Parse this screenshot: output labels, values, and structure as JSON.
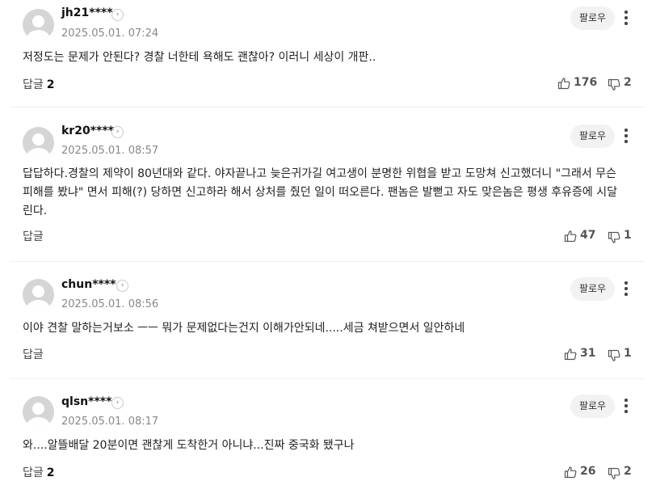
{
  "follow_label": "팔로우",
  "reply_label": "답글",
  "comments": [
    {
      "username": "jh21****",
      "date": "2025.05.01. 07:24",
      "text": "저정도는 문제가 안된다? 경찰 너한테 욕해도 괜찮아? 이러니 세상이 개판..",
      "replies": "2",
      "likes": "176",
      "dislikes": "2"
    },
    {
      "username": "kr20****",
      "date": "2025.05.01. 08:57",
      "text": "답답하다.경찰의 제약이 80년대와 같다. 야자끝나고 늦은귀가길 여고생이 분명한 위협을 받고 도망쳐 신고했더니 \"그래서 무슨 피해를 봤냐\" 면서 피해(?) 당하면 신고하라 해서 상처를 줬던 일이 떠오른다. 팬놈은 발뻗고 자도 맞은놈은 평생 후유증에 시달린다.",
      "replies": "",
      "likes": "47",
      "dislikes": "1"
    },
    {
      "username": "chun****",
      "date": "2025.05.01. 08:56",
      "text": "이야 견찰 말하는거보소 ㅡㅡ 뭐가 문제없다는건지 이해가안되네.....세금 쳐받으면서 일안하네",
      "replies": "",
      "likes": "31",
      "dislikes": "1"
    },
    {
      "username": "qlsn****",
      "date": "2025.05.01. 08:17",
      "text": "와....알뜰배달 20분이면 괜찮게 도착한거 아니냐...진짜 중국화 됐구나",
      "replies": "2",
      "likes": "26",
      "dislikes": "2"
    }
  ]
}
